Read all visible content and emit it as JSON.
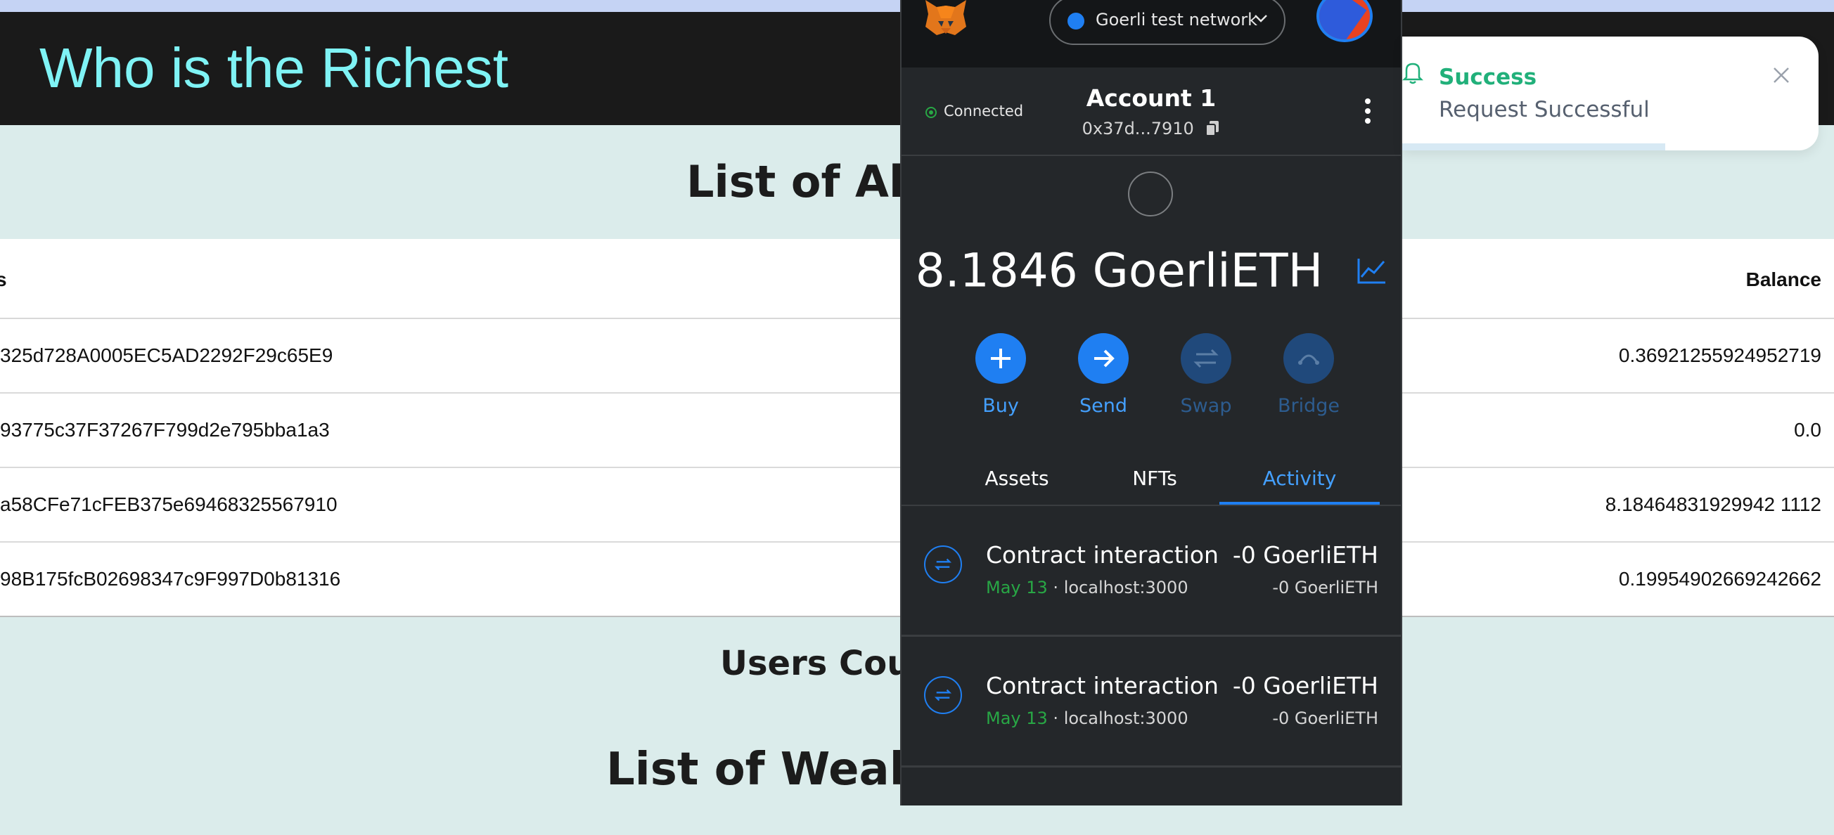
{
  "app": {
    "title": "Who is the Richest"
  },
  "sections": {
    "all_users_title": "List of All U",
    "users_count_title": "Users Count",
    "wealthiest_title": "List of Wealthi"
  },
  "users_table": {
    "headers": {
      "address": "s",
      "balance": "Balance"
    },
    "rows": [
      {
        "address": "325d728A0005EC5AD2292F29c65E9",
        "balance": "0.36921255924952719"
      },
      {
        "address": "93775c37F37267F799d2e795bba1a3",
        "balance": "0.0"
      },
      {
        "address": "a58CFe71cFEB375e69468325567910",
        "balance": "8.18464831929942 1112"
      },
      {
        "address": "98B175fcB02698347c9F997D0b81316",
        "balance": "0.19954902669242662"
      }
    ]
  },
  "wallet": {
    "network": "Goerli test network",
    "connection_status": "Connected",
    "account_name": "Account 1",
    "account_address": "0x37d...7910",
    "balance_amount": "8.1846",
    "balance_unit": "GoerliETH",
    "actions": [
      {
        "label": "Buy",
        "icon": "plus-icon",
        "enabled": true
      },
      {
        "label": "Send",
        "icon": "arrow-right-icon",
        "enabled": true
      },
      {
        "label": "Swap",
        "icon": "swap-icon",
        "enabled": false
      },
      {
        "label": "Bridge",
        "icon": "bridge-icon",
        "enabled": false
      }
    ],
    "tabs": [
      {
        "label": "Assets",
        "active": false
      },
      {
        "label": "NFTs",
        "active": false
      },
      {
        "label": "Activity",
        "active": true
      }
    ],
    "activity": [
      {
        "title": "Contract interaction",
        "date": "May 13",
        "separator": " · ",
        "origin": "localhost:3000",
        "amount": "-0 GoerliETH",
        "amount_secondary": "-0 GoerliETH"
      },
      {
        "title": "Contract interaction",
        "date": "May 13",
        "separator": " · ",
        "origin": "localhost:3000",
        "amount": "-0 GoerliETH",
        "amount_secondary": "-0 GoerliETH"
      }
    ],
    "colors": {
      "accent": "#1f7ff2",
      "success": "#28a745",
      "background": "#24272a"
    }
  },
  "toast": {
    "title": "Success",
    "message": "Request Successful",
    "icon": "bell-icon",
    "progress": 0.63
  }
}
